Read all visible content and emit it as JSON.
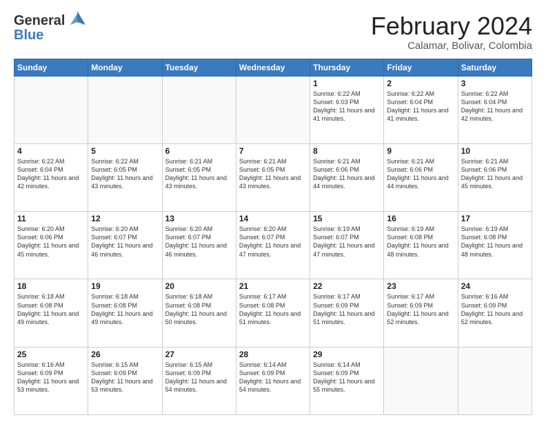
{
  "logo": {
    "general": "General",
    "blue": "Blue"
  },
  "header": {
    "title": "February 2024",
    "subtitle": "Calamar, Bolivar, Colombia"
  },
  "weekdays": [
    "Sunday",
    "Monday",
    "Tuesday",
    "Wednesday",
    "Thursday",
    "Friday",
    "Saturday"
  ],
  "weeks": [
    [
      {
        "day": "",
        "info": ""
      },
      {
        "day": "",
        "info": ""
      },
      {
        "day": "",
        "info": ""
      },
      {
        "day": "",
        "info": ""
      },
      {
        "day": "1",
        "info": "Sunrise: 6:22 AM\nSunset: 6:03 PM\nDaylight: 11 hours and 41 minutes."
      },
      {
        "day": "2",
        "info": "Sunrise: 6:22 AM\nSunset: 6:04 PM\nDaylight: 11 hours and 41 minutes."
      },
      {
        "day": "3",
        "info": "Sunrise: 6:22 AM\nSunset: 6:04 PM\nDaylight: 11 hours and 42 minutes."
      }
    ],
    [
      {
        "day": "4",
        "info": "Sunrise: 6:22 AM\nSunset: 6:04 PM\nDaylight: 11 hours and 42 minutes."
      },
      {
        "day": "5",
        "info": "Sunrise: 6:22 AM\nSunset: 6:05 PM\nDaylight: 11 hours and 43 minutes."
      },
      {
        "day": "6",
        "info": "Sunrise: 6:21 AM\nSunset: 6:05 PM\nDaylight: 11 hours and 43 minutes."
      },
      {
        "day": "7",
        "info": "Sunrise: 6:21 AM\nSunset: 6:05 PM\nDaylight: 11 hours and 43 minutes."
      },
      {
        "day": "8",
        "info": "Sunrise: 6:21 AM\nSunset: 6:06 PM\nDaylight: 11 hours and 44 minutes."
      },
      {
        "day": "9",
        "info": "Sunrise: 6:21 AM\nSunset: 6:06 PM\nDaylight: 11 hours and 44 minutes."
      },
      {
        "day": "10",
        "info": "Sunrise: 6:21 AM\nSunset: 6:06 PM\nDaylight: 11 hours and 45 minutes."
      }
    ],
    [
      {
        "day": "11",
        "info": "Sunrise: 6:20 AM\nSunset: 6:06 PM\nDaylight: 11 hours and 45 minutes."
      },
      {
        "day": "12",
        "info": "Sunrise: 6:20 AM\nSunset: 6:07 PM\nDaylight: 11 hours and 46 minutes."
      },
      {
        "day": "13",
        "info": "Sunrise: 6:20 AM\nSunset: 6:07 PM\nDaylight: 11 hours and 46 minutes."
      },
      {
        "day": "14",
        "info": "Sunrise: 6:20 AM\nSunset: 6:07 PM\nDaylight: 11 hours and 47 minutes."
      },
      {
        "day": "15",
        "info": "Sunrise: 6:19 AM\nSunset: 6:07 PM\nDaylight: 11 hours and 47 minutes."
      },
      {
        "day": "16",
        "info": "Sunrise: 6:19 AM\nSunset: 6:08 PM\nDaylight: 11 hours and 48 minutes."
      },
      {
        "day": "17",
        "info": "Sunrise: 6:19 AM\nSunset: 6:08 PM\nDaylight: 11 hours and 48 minutes."
      }
    ],
    [
      {
        "day": "18",
        "info": "Sunrise: 6:18 AM\nSunset: 6:08 PM\nDaylight: 11 hours and 49 minutes."
      },
      {
        "day": "19",
        "info": "Sunrise: 6:18 AM\nSunset: 6:08 PM\nDaylight: 11 hours and 49 minutes."
      },
      {
        "day": "20",
        "info": "Sunrise: 6:18 AM\nSunset: 6:08 PM\nDaylight: 11 hours and 50 minutes."
      },
      {
        "day": "21",
        "info": "Sunrise: 6:17 AM\nSunset: 6:08 PM\nDaylight: 11 hours and 51 minutes."
      },
      {
        "day": "22",
        "info": "Sunrise: 6:17 AM\nSunset: 6:09 PM\nDaylight: 11 hours and 51 minutes."
      },
      {
        "day": "23",
        "info": "Sunrise: 6:17 AM\nSunset: 6:09 PM\nDaylight: 11 hours and 52 minutes."
      },
      {
        "day": "24",
        "info": "Sunrise: 6:16 AM\nSunset: 6:09 PM\nDaylight: 11 hours and 52 minutes."
      }
    ],
    [
      {
        "day": "25",
        "info": "Sunrise: 6:16 AM\nSunset: 6:09 PM\nDaylight: 11 hours and 53 minutes."
      },
      {
        "day": "26",
        "info": "Sunrise: 6:15 AM\nSunset: 6:09 PM\nDaylight: 11 hours and 53 minutes."
      },
      {
        "day": "27",
        "info": "Sunrise: 6:15 AM\nSunset: 6:09 PM\nDaylight: 11 hours and 54 minutes."
      },
      {
        "day": "28",
        "info": "Sunrise: 6:14 AM\nSunset: 6:09 PM\nDaylight: 11 hours and 54 minutes."
      },
      {
        "day": "29",
        "info": "Sunrise: 6:14 AM\nSunset: 6:09 PM\nDaylight: 11 hours and 55 minutes."
      },
      {
        "day": "",
        "info": ""
      },
      {
        "day": "",
        "info": ""
      }
    ]
  ]
}
